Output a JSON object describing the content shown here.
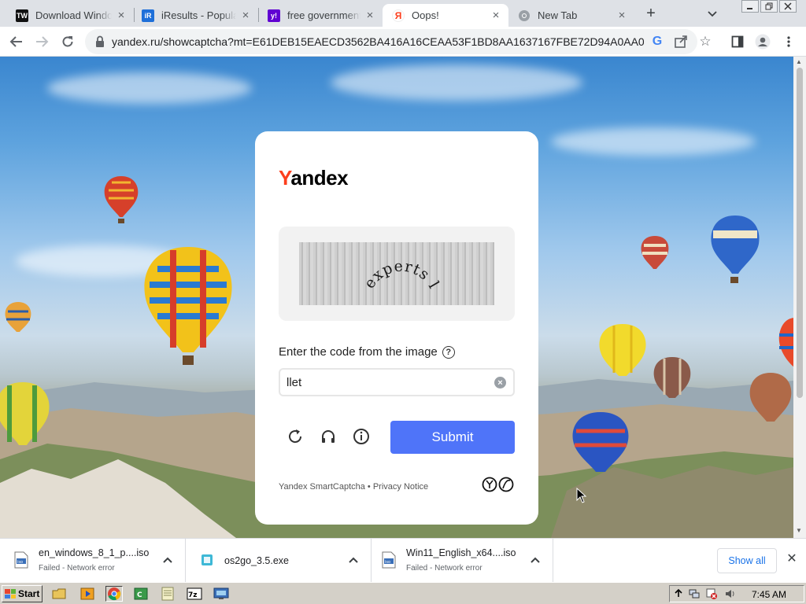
{
  "tabs": [
    {
      "title": "Download Windo",
      "favicon": "TW",
      "favicon_color": "#111111",
      "active": false
    },
    {
      "title": "iResults - Popular",
      "favicon": "iR",
      "favicon_color": "#1e6fd9",
      "active": false
    },
    {
      "title": "free government p",
      "favicon": "y!",
      "favicon_color": "#6001d2",
      "active": false
    },
    {
      "title": "Oops!",
      "favicon": "Я",
      "favicon_color": "#fc3f1d",
      "active": true
    },
    {
      "title": "New Tab",
      "favicon": "chrome",
      "favicon_color": "#5f6368",
      "active": false
    }
  ],
  "window_controls": [
    "minimize-icon",
    "restore-icon",
    "close-icon"
  ],
  "toolbar": {
    "url": "yandex.ru/showcaptcha?mt=E61DEB15EAECD3562BA416A16CEAA53F1BD8AA1637167FBE72D94A0AA026...",
    "icons": [
      "back-icon",
      "forward-icon",
      "reload-icon",
      "google-icon",
      "share-icon",
      "bookmark-star-icon",
      "side-panel-icon",
      "profile-icon",
      "menu-icon"
    ]
  },
  "captcha": {
    "brand_first": "Y",
    "brand_rest": "andex",
    "captcha_words": [
      "experts",
      "lizard"
    ],
    "prompt": "Enter the code from the image",
    "input_value": "llet",
    "submit_label": "Submit",
    "footer_brand": "Yandex SmartCaptcha",
    "footer_separator": " • ",
    "footer_privacy": "Privacy Notice"
  },
  "downloads": [
    {
      "name": "en_windows_8_1_p....iso",
      "status": "Failed - Network error",
      "icon": "iso-file-icon"
    },
    {
      "name": "os2go_3.5.exe",
      "status": "",
      "icon": "exe-file-icon"
    },
    {
      "name": "Win11_English_x64....iso",
      "status": "Failed - Network error",
      "icon": "iso-file-icon"
    }
  ],
  "show_all_label": "Show all",
  "taskbar": {
    "start_label": "Start",
    "clock": "7:45 AM"
  },
  "colors": {
    "accent": "#4f74f9",
    "yandex_red": "#fc3f1d",
    "link_blue": "#1a73e8"
  }
}
